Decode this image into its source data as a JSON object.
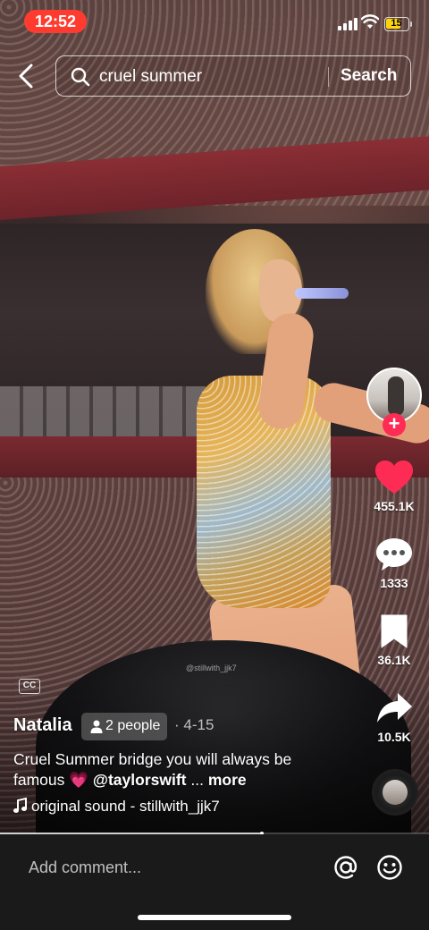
{
  "status_bar": {
    "time": "12:52",
    "battery_level": "15",
    "battery_fraction": 0.15,
    "time_pill_color": "#ff3b30",
    "battery_color": "#ffd60a"
  },
  "search": {
    "query": "cruel summer",
    "button_label": "Search",
    "back_icon": "chevron-left-icon",
    "search_icon": "magnifier-icon"
  },
  "video": {
    "watermark": "@stillwith_jjk7",
    "cc_label": "CC",
    "progress_fraction": 0.61
  },
  "actions": {
    "likes": "455.1K",
    "comments": "1333",
    "saves": "36.1K",
    "shares": "10.5K",
    "like_color": "#fe2c55",
    "follow_color": "#fe2c55",
    "follow_symbol": "+"
  },
  "post": {
    "author": "Natalia",
    "people_chip": "2 people",
    "date": "· 4-15",
    "caption_text": "Cruel Summer bridge you will always be famous 💗 ",
    "mention": "@taylorswift",
    "ellipsis": " ... ",
    "more_label": "more",
    "sound": "original sound - stillwith_jjk7"
  },
  "comment_bar": {
    "placeholder": "Add comment...",
    "mention_icon": "at-sign-icon",
    "emoji_icon": "smiley-icon"
  }
}
